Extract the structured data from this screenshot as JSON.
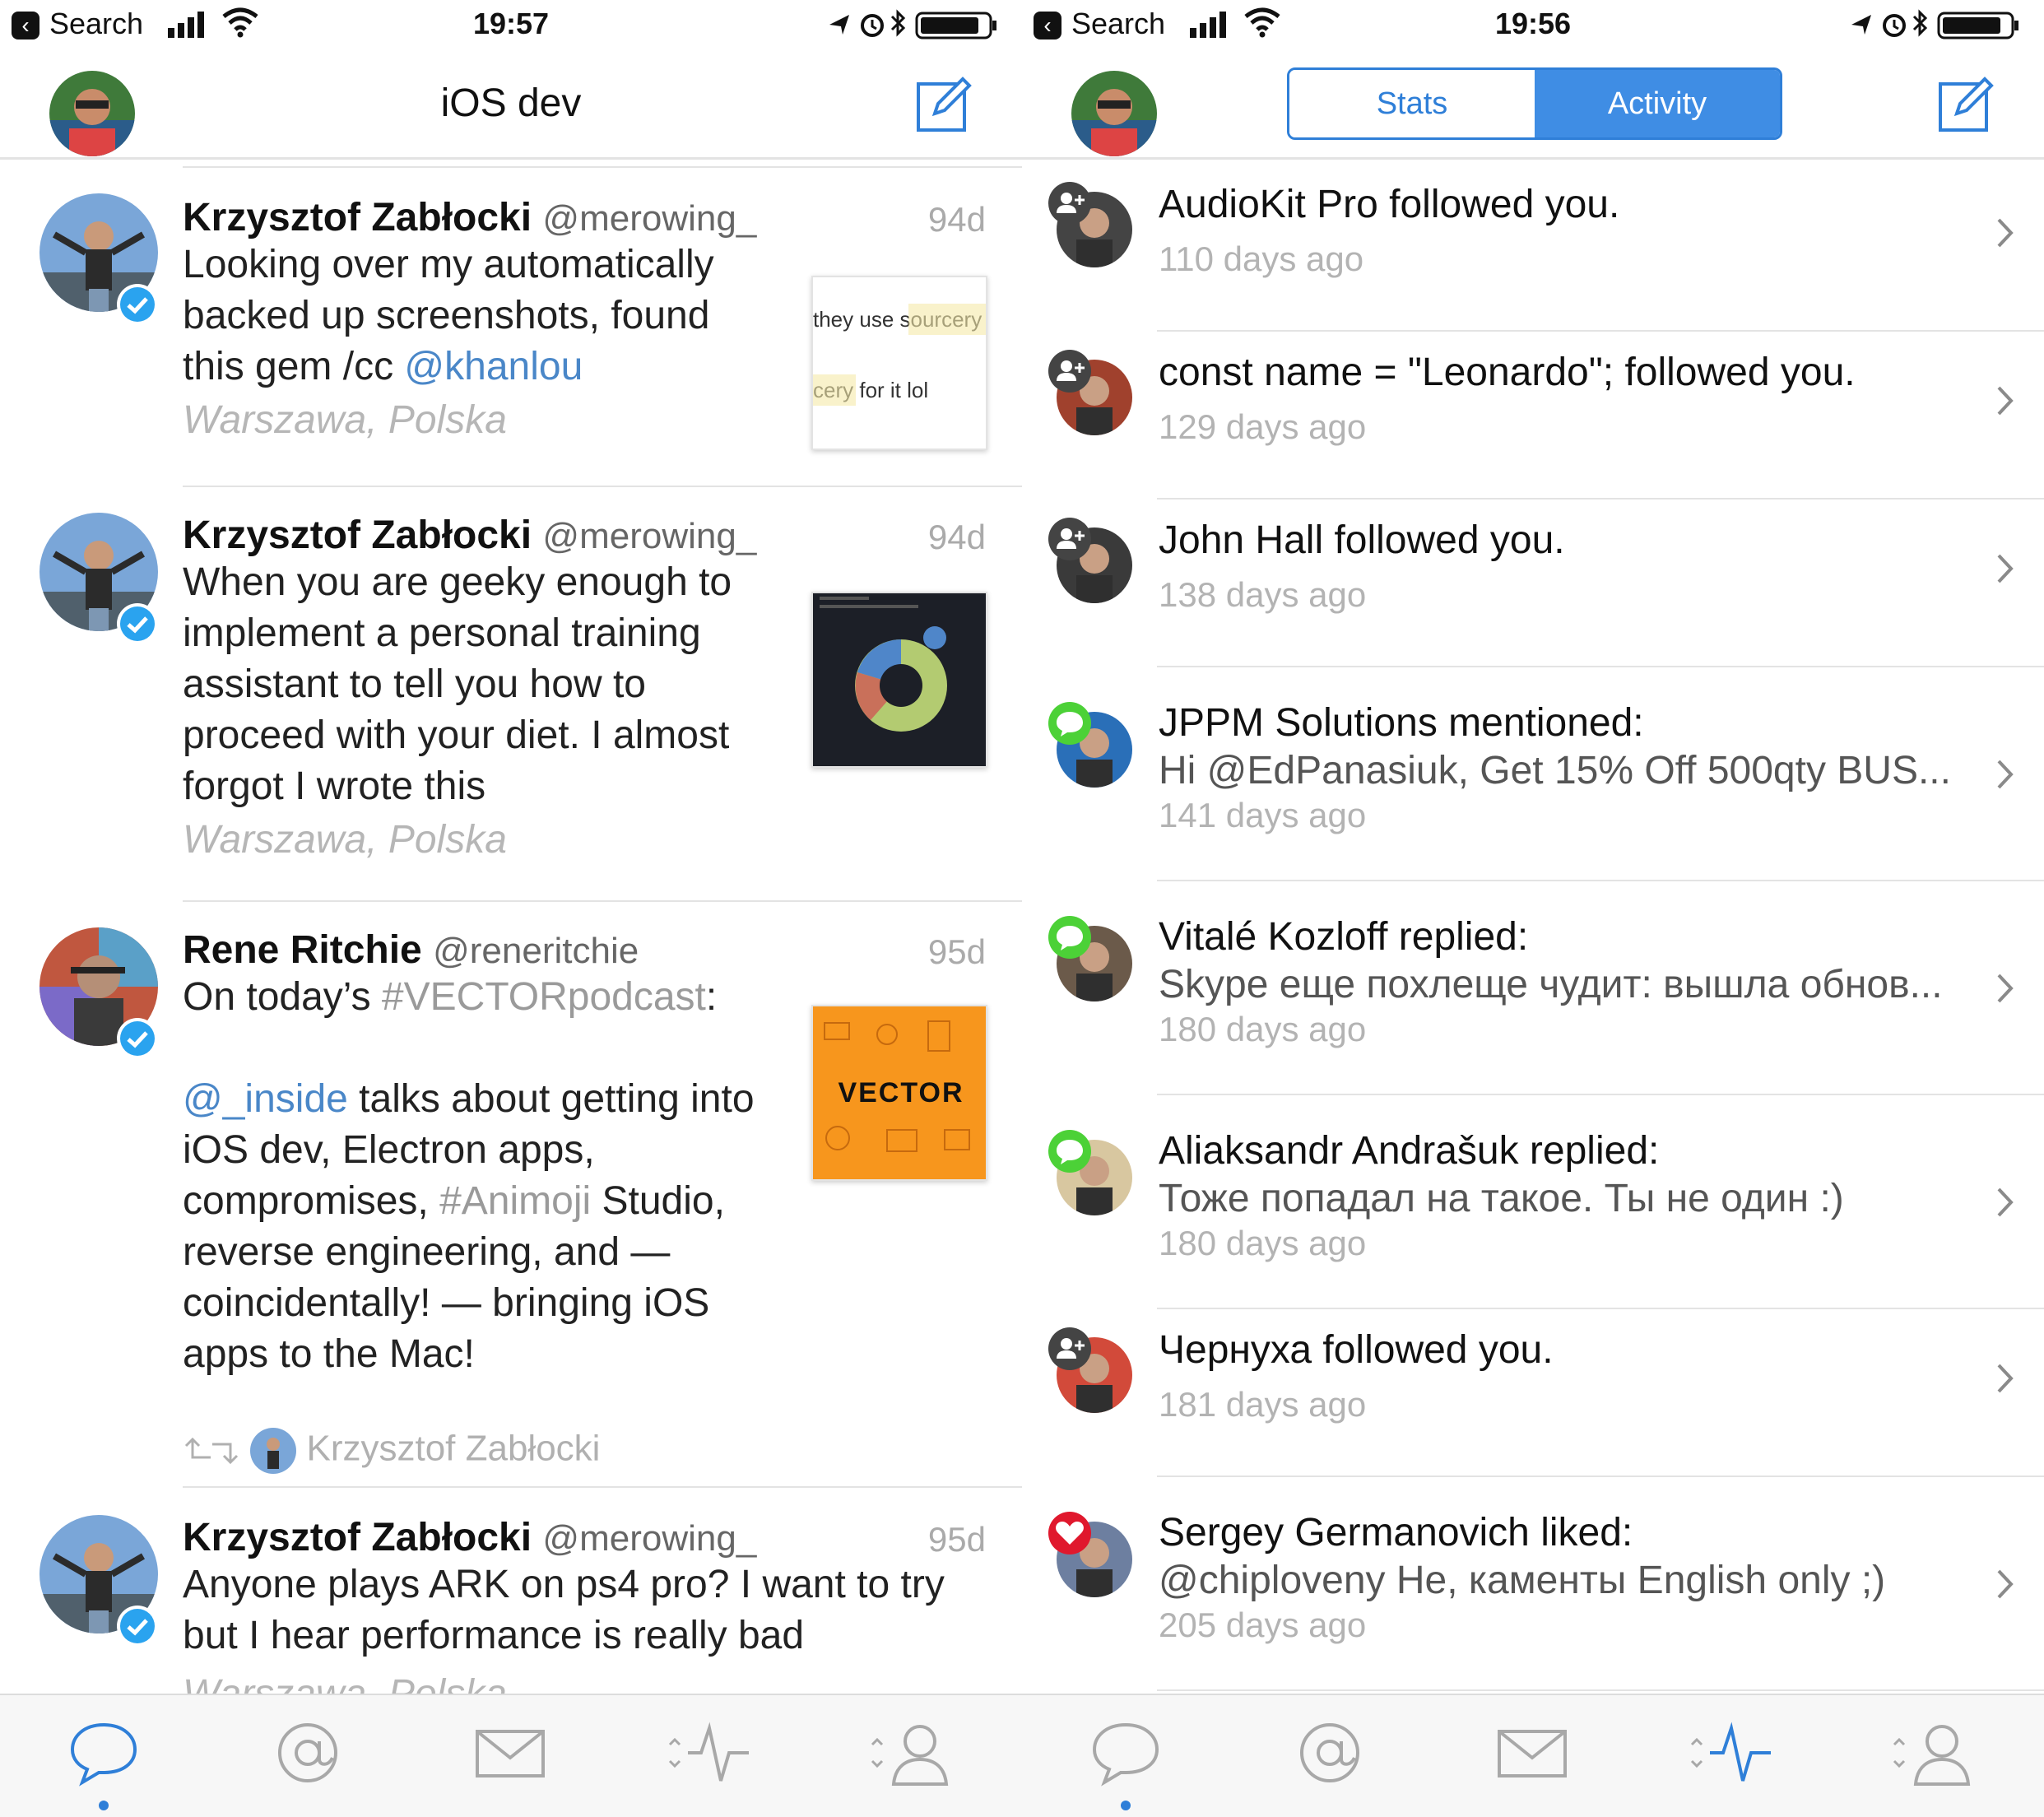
{
  "status_left": {
    "back_label": "Search",
    "time": "19:57"
  },
  "status_right": {
    "back_label": "Search",
    "time": "19:56"
  },
  "left_nav": {
    "title": "iOS dev"
  },
  "right_nav": {
    "tabs": [
      "Stats",
      "Activity"
    ],
    "active_tab": "Activity"
  },
  "tweets": [
    {
      "name": "Krzysztof Zabłocki",
      "handle": "@merowing_",
      "time": "94d",
      "text_parts": [
        "Looking over my automatically backed up screenshots, found this gem /cc ",
        "@khanlou"
      ],
      "location": "Warszawa, Polska",
      "thumb_lines": [
        "they use sourcery",
        "cery for it lol"
      ]
    },
    {
      "name": "Krzysztof Zabłocki",
      "handle": "@merowing_",
      "time": "94d",
      "text": "When you are geeky enough to implement a personal training assistant to tell you how to proceed with your diet. I almost forgot I wrote this",
      "location": "Warszawa, Polska"
    },
    {
      "name": "Rene Ritchie",
      "handle": "@reneritchie",
      "time": "95d",
      "text_a": "On today’s ",
      "hashtag_a": "#VECTORpodcast",
      "text_b": ":",
      "mention": "@_inside",
      "text_c": " talks about getting into iOS dev, Electron apps, compromises, ",
      "hashtag_b": "#Animoji",
      "text_d": " Studio, reverse engineering, and — coincidentally! — bringing iOS apps to the Mac!",
      "retweeted_by": "Krzysztof Zabłocki",
      "thumb_label": "VECTOR"
    },
    {
      "name": "Krzysztof Zabłocki",
      "handle": "@merowing_",
      "time": "95d",
      "text": "Anyone plays ARK on ps4 pro? I want to try but I hear performance is really bad",
      "location": "Warszawa, Polska"
    }
  ],
  "activity": [
    {
      "actor": "AudioKit Pro",
      "action": " followed you.",
      "sub": "",
      "time": "110 days ago",
      "badge": "follow"
    },
    {
      "actor": "const name = \"Leonardo\";",
      "action": " followed you.",
      "sub": "",
      "time": "129 days ago",
      "badge": "follow"
    },
    {
      "actor": "John Hall",
      "action": " followed you.",
      "sub": "",
      "time": "138 days ago",
      "badge": "follow"
    },
    {
      "actor": "JPPM Solutions",
      "action": " mentioned:",
      "sub": "Hi @EdPanasiuk, Get 15% Off 500qty BUS...",
      "time": "141 days ago",
      "badge": "reply"
    },
    {
      "actor": "Vitalé Kozloff",
      "action": " replied:",
      "sub": "Skype еще похлеще чудит: вышла обнов...",
      "time": "180 days ago",
      "badge": "reply"
    },
    {
      "actor": "Aliaksandr Andrašuk",
      "action": " replied:",
      "sub": "Тоже попадал на такое. Ты не один :)",
      "time": "180 days ago",
      "badge": "reply"
    },
    {
      "actor": "Чернуха",
      "action": " followed you.",
      "sub": "",
      "time": "181 days ago",
      "badge": "follow"
    },
    {
      "actor": "Sergey Germanovich",
      "action": " liked:",
      "sub": "@chiploveny Не, каменты English only ;)",
      "time": "205 days ago",
      "badge": "like"
    }
  ],
  "tabbar_icons": [
    "timeline-icon",
    "mentions-icon",
    "messages-icon",
    "activity-icon",
    "profile-icon"
  ],
  "colors": {
    "accent": "#2f7fd8",
    "reply_badge": "#4cd137",
    "like_badge": "#e0182d",
    "follow_badge": "#444444"
  }
}
